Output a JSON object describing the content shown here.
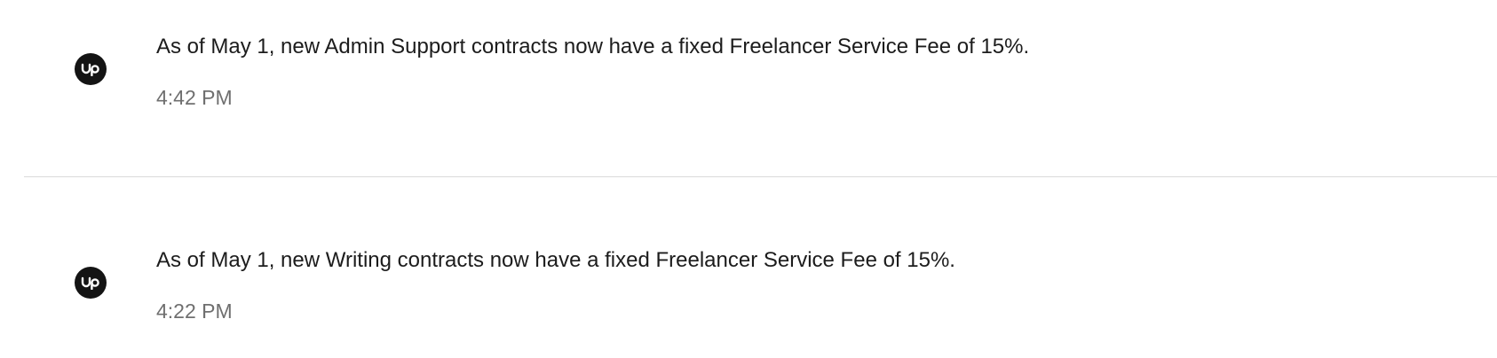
{
  "notifications": [
    {
      "icon": "upwork-logo-icon",
      "message": "As of May 1, new Admin Support contracts now have a fixed Freelancer Service Fee of 15%.",
      "time": "4:42 PM"
    },
    {
      "icon": "upwork-logo-icon",
      "message": "As of May 1, new Writing contracts now have a fixed Freelancer Service Fee of 15%.",
      "time": "4:22 PM"
    }
  ],
  "colors": {
    "avatar_bg": "#141414",
    "text": "#1c1c1c",
    "muted": "#6f6f6f",
    "divider": "#dadada"
  }
}
